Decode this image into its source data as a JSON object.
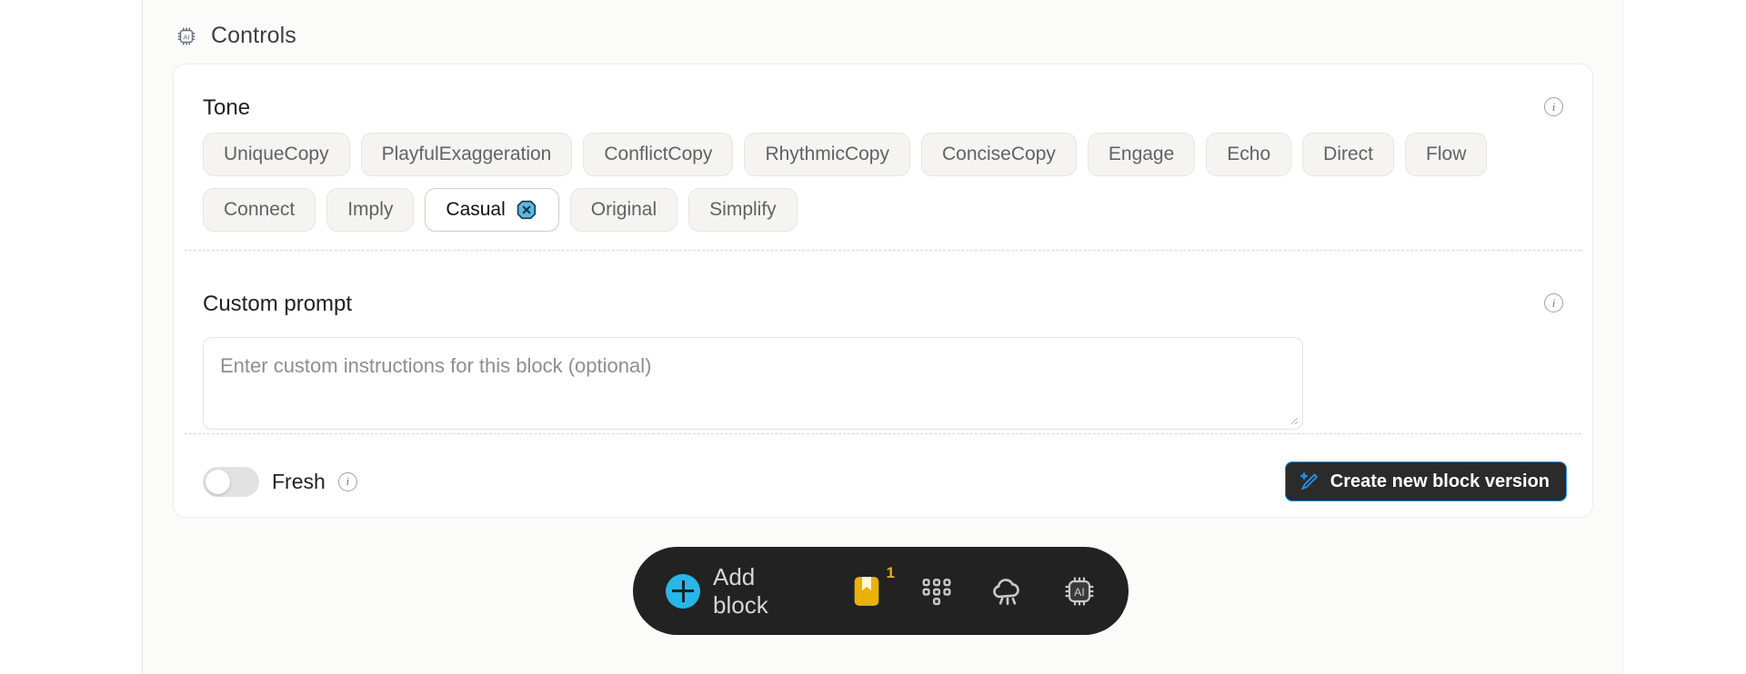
{
  "header": {
    "title": "Controls",
    "icon": "ai-chip-icon"
  },
  "tone": {
    "label": "Tone",
    "info_icon": "info-icon",
    "chips": [
      {
        "label": "UniqueCopy",
        "selected": false
      },
      {
        "label": "PlayfulExaggeration",
        "selected": false
      },
      {
        "label": "ConflictCopy",
        "selected": false
      },
      {
        "label": "RhythmicCopy",
        "selected": false
      },
      {
        "label": "ConciseCopy",
        "selected": false
      },
      {
        "label": "Engage",
        "selected": false
      },
      {
        "label": "Echo",
        "selected": false
      },
      {
        "label": "Direct",
        "selected": false
      },
      {
        "label": "Flow",
        "selected": false
      },
      {
        "label": "Connect",
        "selected": false
      },
      {
        "label": "Imply",
        "selected": false
      },
      {
        "label": "Casual",
        "selected": true,
        "remove_icon": "close-badge-icon"
      },
      {
        "label": "Original",
        "selected": false
      },
      {
        "label": "Simplify",
        "selected": false
      }
    ]
  },
  "custom_prompt": {
    "label": "Custom prompt",
    "info_icon": "info-icon",
    "placeholder": "Enter custom instructions for this block (optional)",
    "value": ""
  },
  "footer": {
    "fresh_label": "Fresh",
    "fresh_enabled": false,
    "fresh_info_icon": "info-icon",
    "create_button": {
      "label": "Create new block version",
      "icon": "magic-wand-icon",
      "border_color": "#2196f3",
      "background": "#2b2b2b"
    }
  },
  "toolbar": {
    "add_block_label": "Add block",
    "add_icon": "plus-circle-icon",
    "items": [
      {
        "name": "bookmark-icon",
        "badge": "1"
      },
      {
        "name": "grid-dots-icon",
        "badge": ""
      },
      {
        "name": "rain-cloud-icon",
        "badge": ""
      },
      {
        "name": "ai-chip-icon",
        "badge": ""
      }
    ]
  },
  "colors": {
    "accent_cyan": "#29b6e8",
    "accent_blue": "#2196f3",
    "bookmark_gold": "#e8b20a",
    "toolbar_bg": "#222222",
    "panel_bg": "#fbfbfa",
    "chip_bg": "#f5f4f0"
  }
}
